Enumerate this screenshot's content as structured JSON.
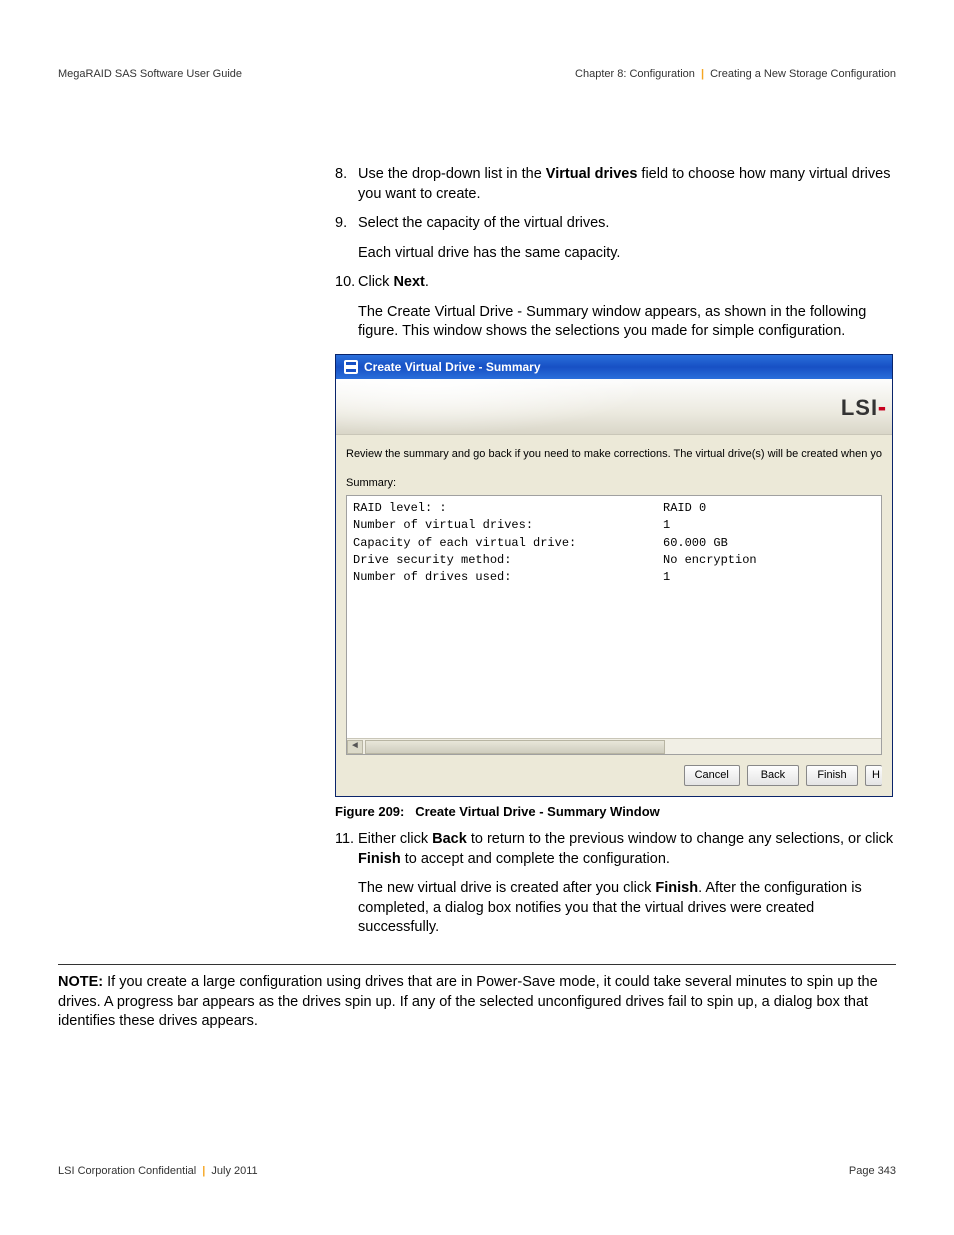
{
  "header": {
    "left": "MegaRAID SAS Software User Guide",
    "chapter": "Chapter 8: Configuration",
    "section": "Creating a New Storage Configuration"
  },
  "steps": {
    "s8_num": "8.",
    "s8_pre": "Use the drop-down list in the ",
    "s8_bold": "Virtual drives",
    "s8_post": " field to choose how many virtual drives you want to create.",
    "s9_num": "9.",
    "s9": "Select the capacity of the virtual drives.",
    "s9_sub": "Each virtual drive has the same capacity.",
    "s10_num": "10.",
    "s10_pre": "Click ",
    "s10_bold": "Next",
    "s10_post": ".",
    "s10_sub": "The Create Virtual Drive - Summary window appears, as shown in the following figure. This window shows the selections you made for simple configuration.",
    "s11_num": "11.",
    "s11_pre": "Either click ",
    "s11_b1": "Back",
    "s11_mid": " to return to the previous window to change any selections, or click ",
    "s11_b2": "Finish",
    "s11_post": " to accept and complete the configuration.",
    "s11_sub_pre": "The new virtual drive is created after you click ",
    "s11_sub_b": "Finish",
    "s11_sub_post": ". After the configuration is completed, a dialog box notifies you that the virtual drives were created successfully."
  },
  "dialog": {
    "title": "Create Virtual Drive - Summary",
    "logo": "LSI",
    "desc": "Review the summary and go back if you need to make corrections. The virtual drive(s) will be created when you click finish",
    "label": "Summary:",
    "rows": [
      {
        "k": "RAID level: :",
        "v": "RAID 0"
      },
      {
        "k": "Number of virtual drives:",
        "v": "1"
      },
      {
        "k": "Capacity of each virtual drive:",
        "v": "60.000 GB"
      },
      {
        "k": "Drive security method:",
        "v": "No encryption"
      },
      {
        "k": "Number of drives used:",
        "v": "1"
      }
    ],
    "buttons": {
      "cancel": "Cancel",
      "back": "Back",
      "finish": "Finish",
      "cut": "H"
    }
  },
  "figure": {
    "caption_pre": "Figure 209:",
    "caption": "Create Virtual Drive - Summary Window"
  },
  "note": {
    "label": "NOTE:",
    "body": "  If you create a large configuration using drives that are in Power-Save mode, it could take several minutes to spin up the drives. A progress bar appears as the drives spin up. If any of the selected unconfigured drives fail to spin up, a dialog box that identifies these drives appears."
  },
  "footer": {
    "left_a": "LSI Corporation Confidential",
    "left_b": "July 2011",
    "right": "Page 343"
  }
}
